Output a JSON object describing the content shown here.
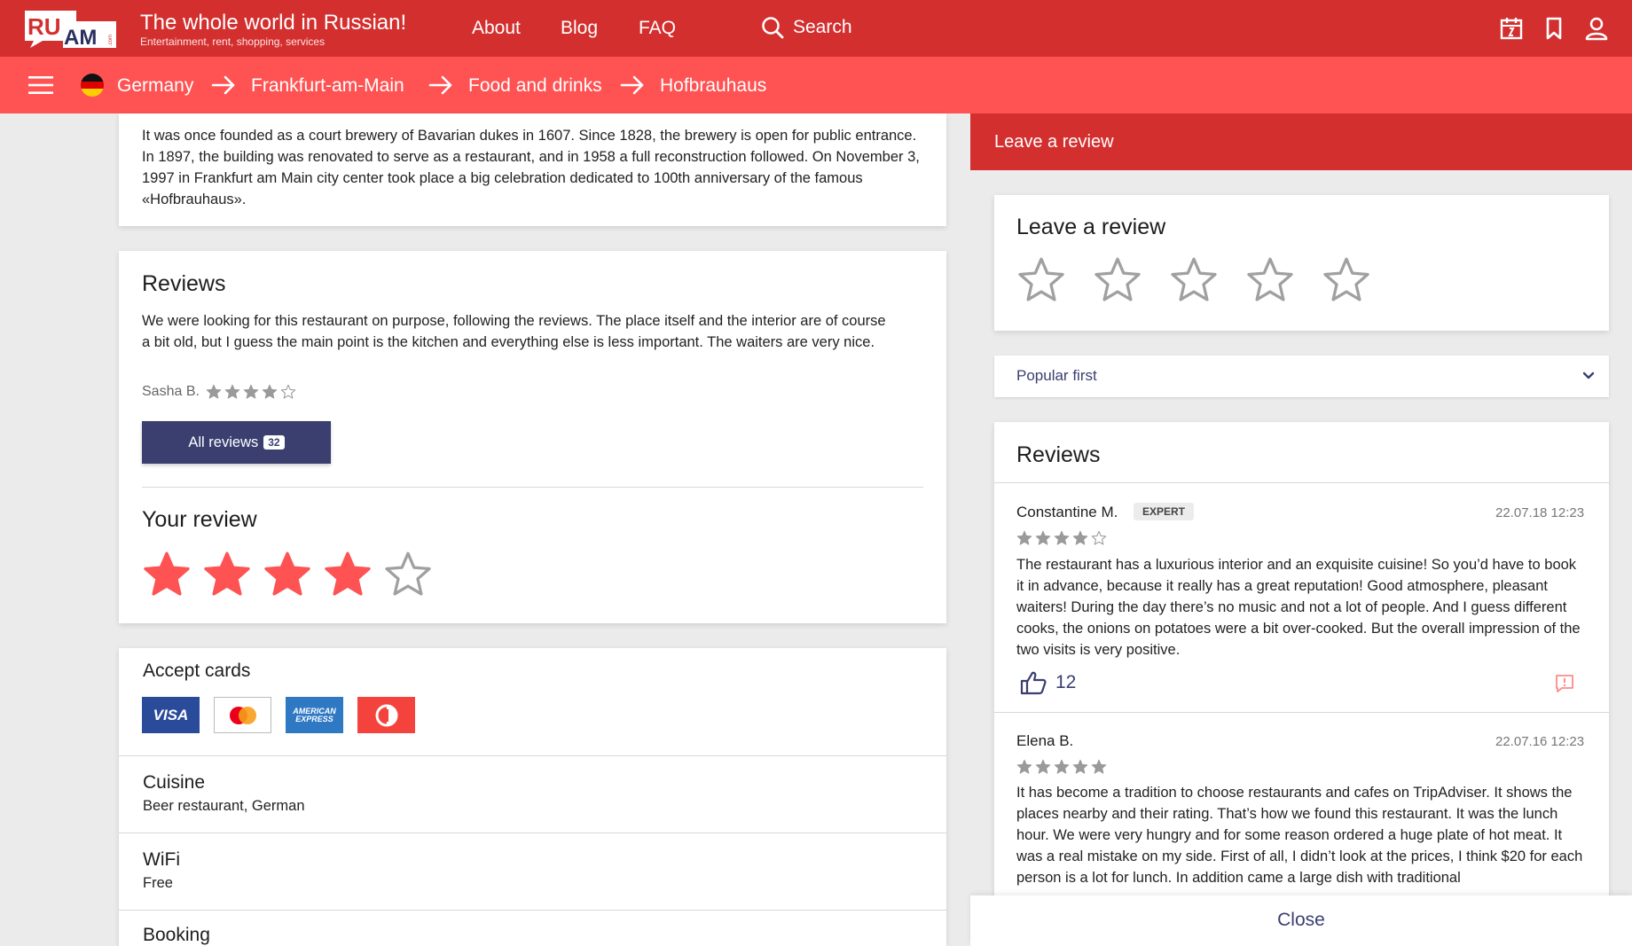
{
  "header": {
    "logo_text_ru": "RU",
    "logo_text_am": "AM",
    "logo_text_com": ".com",
    "title": "The whole world in Russian!",
    "subtitle": "Entertainment, rent, shopping, services",
    "nav": [
      "About",
      "Blog",
      "FAQ"
    ],
    "search_label": "Search",
    "icons": [
      "calendar-icon",
      "bookmark-icon",
      "user-icon"
    ]
  },
  "breadcrumb": [
    "Germany",
    "Frankfurt-am-Main",
    "Food and drinks",
    "Hofbrauhaus"
  ],
  "intro": {
    "text": "It was once founded as a court brewery of Bavarian dukes in 1607. Since 1828, the brewery is open for public entrance. In 1897, the building was renovated to serve as a restaurant, and in 1958 a full reconstruction followed. On November 3, 1997 in Frankfurt am Main city center took place a big celebration dedicated to 100th anniversary of the famous «Hofbrauhaus»."
  },
  "reviews_card": {
    "title": "Reviews",
    "text": "We were looking for this restaurant on purpose, following the reviews. The place itself and the interior are of course a bit old, but I guess the main point is the kitchen and everything else is less important. The waiters are very nice.",
    "author": "Sasha B.",
    "rating": 4,
    "all_reviews_label": "All reviews",
    "all_reviews_count": "32",
    "your_review_title": "Your review",
    "your_rating": 4
  },
  "payment": {
    "title": "Accept cards",
    "cards": [
      {
        "name": "VISA",
        "icon": "visa-card",
        "bg": "#2a4a9a",
        "fg": "#ffffff"
      },
      {
        "name": "MasterCard",
        "icon": "mastercard-card",
        "bg": "#ffffff",
        "fg": "#e53935"
      },
      {
        "name": "AMERICAN EXPRESS",
        "icon": "amex-card",
        "bg": "#2f78c4",
        "fg": "#ffffff"
      },
      {
        "name": "",
        "icon": "diners-card",
        "bg": "#f4433c",
        "fg": "#ffffff"
      }
    ]
  },
  "info": [
    {
      "label": "Cuisine",
      "value": "Beer restaurant, German"
    },
    {
      "label": "WiFi",
      "value": "Free"
    },
    {
      "label": "Booking",
      "value": ""
    }
  ],
  "panel": {
    "header": "Leave a review",
    "leave_title": "Leave a review",
    "leave_rating": 0,
    "sort_value": "Popular first",
    "reviews_title": "Reviews",
    "reviews": [
      {
        "name": "Constantine M.",
        "badge": "EXPERT",
        "date": "22.07.18 12:23",
        "rating": 4,
        "text": "The restaurant has a luxurious interior and an exquisite cuisine! So you’d have to book it in advance, because it really has a great reputation! Good atmosphere, pleasant waiters! During the day there’s no music and not a lot of people. And I guess different cooks, the onions on potatoes were a bit over-cooked. But the overall impression of the two visits is very positive.",
        "likes": "12"
      },
      {
        "name": "Elena B.",
        "date": "22.07.16 12:23",
        "rating": 5,
        "text": "It has become a tradition to choose restaurants and cafes on TripAdviser. It shows the places nearby and their rating. That’s how we found this restaurant. It was the lunch hour. We were very hungry and for some reason ordered a huge plate of hot meat. It was a real mistake on my side. First of all, I didn’t look at the prices, I think $20 for each person is a lot for lunch. In addition came a large dish with traditional"
      }
    ],
    "close_label": "Close"
  },
  "colors": {
    "topbar": "#d32f2f",
    "crumbbar": "#ff5252",
    "star_active": "#ff5252",
    "navy": "#3a3f70"
  }
}
